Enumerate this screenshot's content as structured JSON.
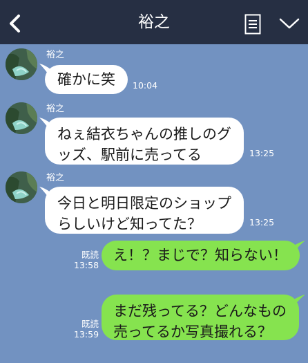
{
  "header": {
    "back_icon": "chevron-left-icon",
    "title": "裕之",
    "note_icon": "note-icon",
    "menu_icon": "chevron-down-icon"
  },
  "messages": [
    {
      "sender": "裕之",
      "lines": [
        "確かに笑"
      ],
      "time": "10:04"
    },
    {
      "sender": "裕之",
      "lines": [
        "ねぇ結衣ちゃんの推しのグ",
        "ッズ、駅前に売ってる"
      ],
      "time": "13:25"
    },
    {
      "sender": "裕之",
      "lines": [
        "今日と明日限定のショップ",
        "らしいけど知ってた？"
      ],
      "time": "13:25"
    },
    {
      "sender": "me",
      "read": "既読",
      "lines": [
        "え！？まじで？知らない！"
      ],
      "time": "13:58"
    },
    {
      "sender": "me",
      "read": "既読",
      "lines": [
        "まだ残ってる？どんなもの",
        "売ってるか写真撮れる？"
      ],
      "time": "13:59"
    }
  ],
  "colors": {
    "background": "#7292c1",
    "header": "#262f43",
    "incoming_bubble": "#ffffff",
    "outgoing_bubble": "#86e34f"
  }
}
